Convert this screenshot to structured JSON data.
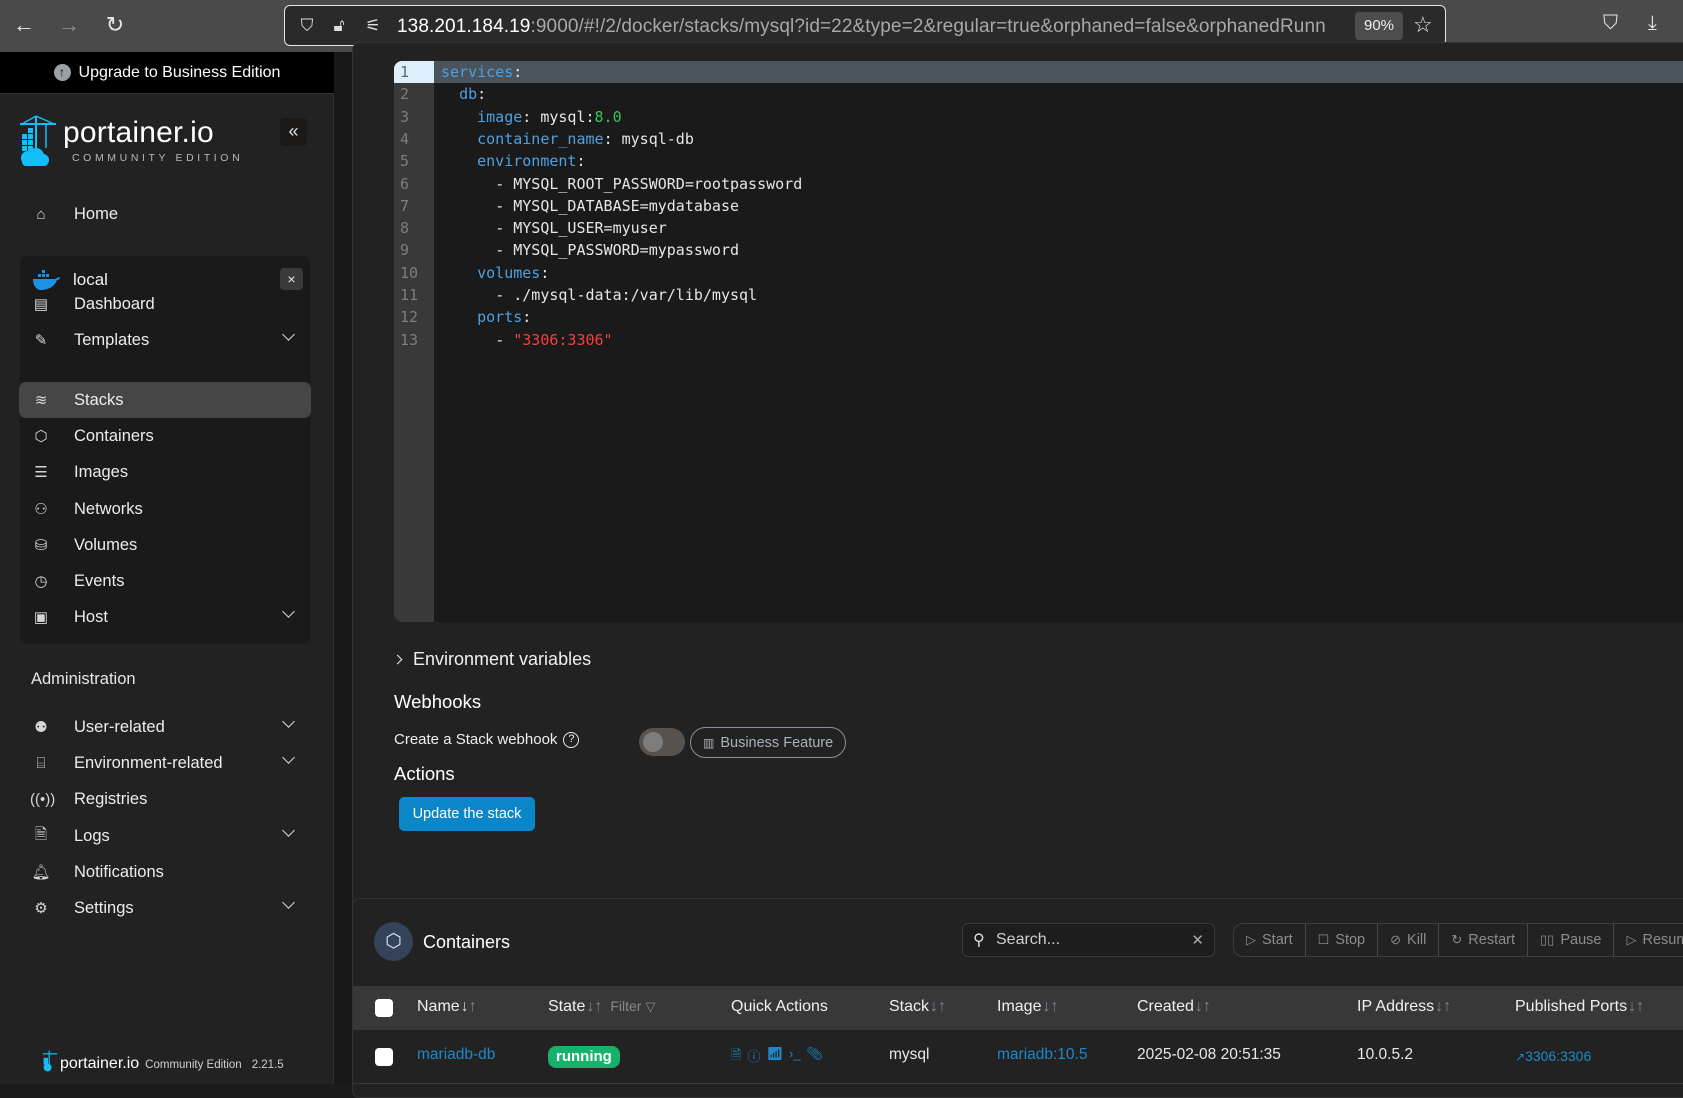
{
  "browser": {
    "url_host": "138.201.184.19",
    "url_rest": ":9000/#!/2/docker/stacks/mysql?id=22&type=2&regular=true&orphaned=false&orphanedRunn",
    "zoom_level": "90%",
    "icons": [
      "back-icon",
      "forward-icon",
      "reload-icon",
      "shield-icon",
      "insecure-lock-icon",
      "permissions-icon",
      "bookmark-star-icon",
      "pocket-icon",
      "download-icon"
    ]
  },
  "sidebar": {
    "upgrade_label": "Upgrade to Business Edition",
    "brand": "portainer.io",
    "brand_sub": "COMMUNITY EDITION",
    "collapse_label": "«",
    "home_label": "Home",
    "environment": {
      "name": "local",
      "close_label": "×",
      "items": [
        {
          "label": "Dashboard",
          "icon": "dashboard-icon",
          "expandable": false
        },
        {
          "label": "Templates",
          "icon": "edit-icon",
          "expandable": true
        },
        {
          "label": "Stacks",
          "icon": "layers-icon",
          "expandable": false,
          "active": true
        },
        {
          "label": "Containers",
          "icon": "box-icon",
          "expandable": false
        },
        {
          "label": "Images",
          "icon": "list-icon",
          "expandable": false
        },
        {
          "label": "Networks",
          "icon": "network-icon",
          "expandable": false
        },
        {
          "label": "Volumes",
          "icon": "database-icon",
          "expandable": false
        },
        {
          "label": "Events",
          "icon": "clock-icon",
          "expandable": false
        },
        {
          "label": "Host",
          "icon": "host-icon",
          "expandable": true
        }
      ]
    },
    "admin_label": "Administration",
    "admin_items": [
      {
        "label": "User-related",
        "icon": "users-icon",
        "expandable": true
      },
      {
        "label": "Environment-related",
        "icon": "hard-drive-icon",
        "expandable": true
      },
      {
        "label": "Registries",
        "icon": "radio-icon",
        "expandable": false
      },
      {
        "label": "Logs",
        "icon": "file-text-icon",
        "expandable": true
      },
      {
        "label": "Notifications",
        "icon": "bell-icon",
        "expandable": false
      },
      {
        "label": "Settings",
        "icon": "gear-icon",
        "expandable": true
      }
    ],
    "footer": {
      "brand": "portainer.io",
      "edition": "Community Edition",
      "version": "2.21.5"
    }
  },
  "editor": {
    "lines": [
      {
        "n": "1",
        "tokens": [
          [
            "k",
            "services"
          ],
          [
            "p",
            ":"
          ]
        ],
        "indent": 0
      },
      {
        "n": "2",
        "tokens": [
          [
            "k",
            "db"
          ],
          [
            "p",
            ":"
          ]
        ],
        "indent": 2
      },
      {
        "n": "3",
        "tokens": [
          [
            "k",
            "image"
          ],
          [
            "p",
            ": mysql:"
          ],
          [
            "n",
            "8.0"
          ]
        ],
        "indent": 4
      },
      {
        "n": "4",
        "tokens": [
          [
            "k",
            "container_name"
          ],
          [
            "p",
            ": mysql-db"
          ]
        ],
        "indent": 4
      },
      {
        "n": "5",
        "tokens": [
          [
            "k",
            "environment"
          ],
          [
            "p",
            ":"
          ]
        ],
        "indent": 4
      },
      {
        "n": "6",
        "tokens": [
          [
            "p",
            "- MYSQL_ROOT_PASSWORD=rootpassword"
          ]
        ],
        "indent": 6
      },
      {
        "n": "7",
        "tokens": [
          [
            "p",
            "- MYSQL_DATABASE=mydatabase"
          ]
        ],
        "indent": 6
      },
      {
        "n": "8",
        "tokens": [
          [
            "p",
            "- MYSQL_USER=myuser"
          ]
        ],
        "indent": 6
      },
      {
        "n": "9",
        "tokens": [
          [
            "p",
            "- MYSQL_PASSWORD=mypassword"
          ]
        ],
        "indent": 6
      },
      {
        "n": "10",
        "tokens": [
          [
            "k",
            "volumes"
          ],
          [
            "p",
            ":"
          ]
        ],
        "indent": 4
      },
      {
        "n": "11",
        "tokens": [
          [
            "p",
            "- ./mysql-data:/var/lib/mysql"
          ]
        ],
        "indent": 6
      },
      {
        "n": "12",
        "tokens": [
          [
            "k",
            "ports"
          ],
          [
            "p",
            ":"
          ]
        ],
        "indent": 4
      },
      {
        "n": "13",
        "tokens": [
          [
            "p",
            "- "
          ],
          [
            "s",
            "\"3306:3306\""
          ]
        ],
        "indent": 6
      }
    ],
    "current_line": 1
  },
  "stack": {
    "env_vars_label": "Environment variables",
    "webhooks_title": "Webhooks",
    "webhook_label": "Create a Stack webhook",
    "webhook_enabled": false,
    "business_badge": "Business Feature",
    "actions_title": "Actions",
    "update_button": "Update the stack"
  },
  "containers": {
    "title": "Containers",
    "search_placeholder": "Search...",
    "actions": [
      {
        "label": "Start",
        "icon": "play-icon"
      },
      {
        "label": "Stop",
        "icon": "square-icon"
      },
      {
        "label": "Kill",
        "icon": "ban-icon"
      },
      {
        "label": "Restart",
        "icon": "refresh-icon"
      },
      {
        "label": "Pause",
        "icon": "pause-icon"
      },
      {
        "label": "Resume",
        "icon": "play-icon"
      }
    ],
    "columns": [
      "Name",
      "State",
      "Quick Actions",
      "Stack",
      "Image",
      "Created",
      "IP Address",
      "Published Ports"
    ],
    "filter_label": "Filter",
    "rows": [
      {
        "name": "mariadb-db",
        "state": "running",
        "stack": "mysql",
        "image": "mariadb:10.5",
        "created": "2025-02-08 20:51:35",
        "ip": "10.0.5.2",
        "ports": "3306:3306"
      }
    ],
    "colors": {
      "running": "#16b26b",
      "link": "#1e88c8",
      "primary": "#0b86c9"
    }
  }
}
